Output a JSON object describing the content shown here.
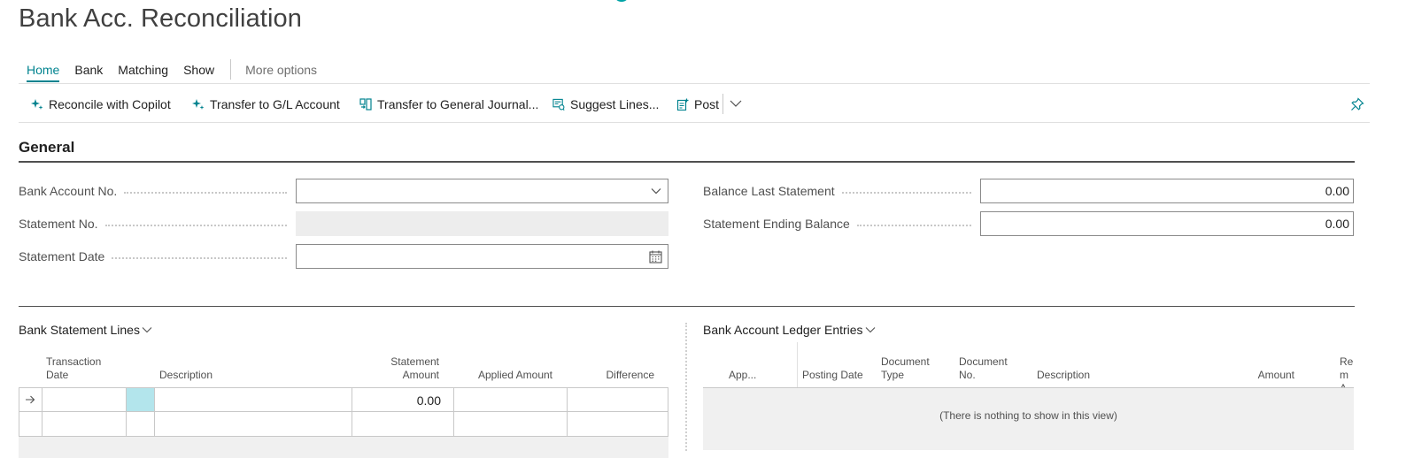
{
  "page": {
    "title": "Bank Acc. Reconciliation"
  },
  "menu": {
    "tabs": [
      "Home",
      "Bank",
      "Matching",
      "Show"
    ],
    "active_tab": "Home",
    "more_options": "More options"
  },
  "actions": {
    "reconcile_copilot": {
      "label": "Reconcile with Copilot",
      "icon": "copilot-sparkle-icon"
    },
    "transfer_gl": {
      "label": "Transfer to G/L Account",
      "icon": "copilot-sparkle-icon"
    },
    "transfer_journal": {
      "label": "Transfer to General Journal...",
      "icon": "transfer-journal-icon"
    },
    "suggest_lines": {
      "label": "Suggest Lines...",
      "icon": "suggest-lines-icon"
    },
    "post": {
      "label": "Post",
      "icon": "post-icon"
    }
  },
  "general": {
    "title": "General",
    "bank_account_no": {
      "label": "Bank Account No.",
      "value": ""
    },
    "statement_no": {
      "label": "Statement No.",
      "value": ""
    },
    "statement_date": {
      "label": "Statement Date",
      "value": ""
    },
    "balance_last_statement": {
      "label": "Balance Last Statement",
      "value": "0.00"
    },
    "statement_ending_balance": {
      "label": "Statement Ending Balance",
      "value": "0.00"
    }
  },
  "bank_statement_lines": {
    "title": "Bank Statement Lines",
    "columns": {
      "transaction_date": "Transaction Date",
      "description": "Description",
      "statement_amount": "Statement Amount",
      "applied_amount": "Applied Amount",
      "difference": "Difference"
    },
    "rows": [
      {
        "transaction_date": "",
        "description": "",
        "statement_amount": "0.00",
        "applied_amount": "",
        "difference": ""
      },
      {
        "transaction_date": "",
        "description": "",
        "statement_amount": "",
        "applied_amount": "",
        "difference": ""
      }
    ]
  },
  "ledger_entries": {
    "title": "Bank Account Ledger Entries",
    "columns": {
      "app": "App...",
      "posting_date": "Posting Date",
      "document_type": "Document Type",
      "document_no": "Document No.",
      "description": "Description",
      "amount": "Amount",
      "remaining": "Rem A"
    },
    "empty_text": "(There is nothing to show in this view)"
  },
  "colors": {
    "accent": "#00838f",
    "active_cell": "#b3e5ec",
    "readonly_field": "#ededed"
  }
}
